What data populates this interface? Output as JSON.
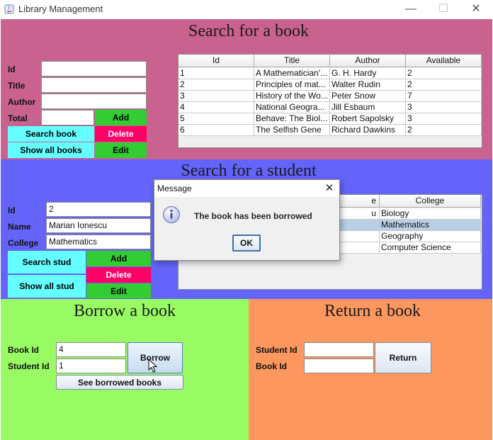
{
  "window": {
    "title": "Library Management",
    "minimize": "—",
    "maximize": "☐",
    "close": "✕"
  },
  "search_book": {
    "heading": "Search for a book",
    "labels": {
      "id": "Id",
      "title": "Title",
      "author": "Author",
      "total": "Total"
    },
    "values": {
      "id": "",
      "title": "",
      "author": "",
      "total": ""
    },
    "buttons": {
      "add": "Add",
      "search": "Search book",
      "delete": "Delete",
      "show_all": "Show all books",
      "edit": "Edit"
    },
    "table": {
      "columns": [
        "Id",
        "Title",
        "Author",
        "Available"
      ],
      "rows": [
        [
          "1",
          "A Mathematician'...",
          "G. H. Hardy",
          "2"
        ],
        [
          "2",
          "Principles of mat...",
          "Walter Rudin",
          "2"
        ],
        [
          "3",
          "History of the Wo...",
          "Peter Snow",
          "7"
        ],
        [
          "4",
          "National Geogra...",
          "Jill Esbaum",
          "3"
        ],
        [
          "5",
          "Behave: The Biol...",
          "Robert Sapolsky",
          "3"
        ],
        [
          "6",
          "The Selfish Gene",
          "Richard Dawkins",
          "2"
        ]
      ]
    }
  },
  "search_student": {
    "heading": "Search for a student",
    "labels": {
      "id": "Id",
      "name": "Name",
      "college": "College"
    },
    "values": {
      "id": "2",
      "name": "Marian Ionescu",
      "college": "Mathematics"
    },
    "buttons": {
      "search": "Search stud",
      "show_all": "Show all stud",
      "add": "Add",
      "delete": "Delete",
      "edit": "Edit"
    },
    "table": {
      "columns": [
        "e",
        "College"
      ],
      "rows": [
        [
          "u",
          "Biology"
        ],
        [
          "",
          "Mathematics"
        ],
        [
          "",
          "Geography"
        ],
        [
          "",
          "Computer Science"
        ]
      ],
      "selected_row": 1
    }
  },
  "borrow": {
    "heading": "Borrow a book",
    "labels": {
      "book_id": "Book Id",
      "student_id": "Student Id"
    },
    "values": {
      "book_id": "4",
      "student_id": "1"
    },
    "buttons": {
      "borrow": "Borrow",
      "see_borrowed": "See borrowed books"
    }
  },
  "return": {
    "heading": "Return a book",
    "labels": {
      "student_id": "Student Id",
      "book_id": "Book Id"
    },
    "values": {
      "student_id": "",
      "book_id": ""
    },
    "buttons": {
      "return": "Return"
    }
  },
  "dialog": {
    "title": "Message",
    "message": "The book has been borrowed",
    "ok": "OK",
    "close": "✕",
    "icon": "info-icon"
  },
  "colors": {
    "book_panel": "#c9628f",
    "student_panel": "#6464fa",
    "borrow_panel": "#99fb63",
    "return_panel": "#fb975f",
    "cyan_button": "#66ffff",
    "green_button": "#33cc33",
    "delete_button": "#ff0066"
  }
}
